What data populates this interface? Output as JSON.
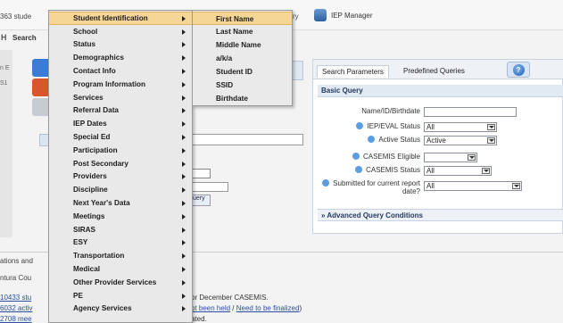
{
  "topbar": {
    "count_text": "363 stude",
    "partial_text": "ry",
    "iep_manager": "IEP Manager",
    "icon": "iep-manager-icon"
  },
  "header": {
    "h_text": "H",
    "search_text": "Search"
  },
  "left_edge": {
    "t1": "n E",
    "t2": "S1"
  },
  "right_panel": {
    "tabs": [
      "Search Parameters",
      "Predefined Queries"
    ],
    "help_icon": "help-icon",
    "basic_query": "Basic Query",
    "fields": [
      {
        "label": "Name/ID/Birthdate",
        "value": "",
        "type": "text"
      },
      {
        "label": "IEP/EVAL Status",
        "value": "All",
        "type": "select"
      },
      {
        "label": "Active Status",
        "value": "Active",
        "type": "select"
      },
      {
        "label": "CASEMIS Eligible",
        "value": "",
        "type": "select"
      },
      {
        "label": "CASEMIS Status",
        "value": "All",
        "type": "select"
      },
      {
        "label": "Submitted for current report date?",
        "value": "All",
        "type": "select"
      }
    ],
    "advanced": "» Advanced Query Conditions"
  },
  "background": {
    "query_button": "uery"
  },
  "bottom": {
    "section": "ations and",
    "county": "ntura Cou",
    "links": [
      "10433 stu",
      "6032 activ",
      "2708 mee"
    ],
    "msg1": "or December CASEMIS.",
    "msg2_link1": "ot been held",
    "msg2_sep": " / ",
    "msg2_link2": "Need to be finalized",
    "msg2_end": ")",
    "msg3": "ated."
  },
  "menu": {
    "items": [
      "Student Identification",
      "School",
      "Status",
      "Demographics",
      "Contact Info",
      "Program Information",
      "Services",
      "Referral Data",
      "IEP Dates",
      "Special Ed",
      "Participation",
      "Post Secondary",
      "Providers",
      "Discipline",
      "Next Year's Data",
      "Meetings",
      "SIRAS",
      "ESY",
      "Transportation",
      "Medical",
      "Other Provider Services",
      "PE",
      "Agency Services"
    ],
    "submenu": [
      "First Name",
      "Last Name",
      "Middle Name",
      "a/k/a",
      "Student ID",
      "SSID",
      "Birthdate"
    ]
  },
  "colors": {
    "highlight": "#f6d697",
    "menu_bg": "#e9e9e9",
    "link": "#2a4fa0"
  }
}
